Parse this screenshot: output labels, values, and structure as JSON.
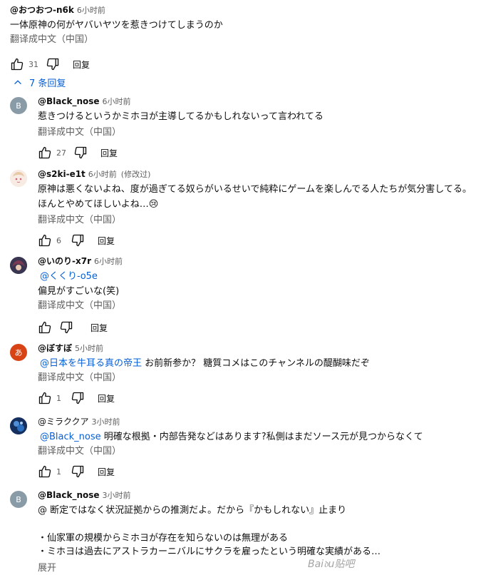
{
  "top_comment": {
    "author": "@おつおつ-n6k",
    "time": "6小时前",
    "text": "一体原神の何がヤバいヤツを惹きつけてしまうのか",
    "translate": "翻译成中文（中国）",
    "likes": "31",
    "reply_label": "回复"
  },
  "replies_toggle": {
    "label": "7 条回复"
  },
  "replies": [
    {
      "author": "@Black_nose",
      "time": "6小时前",
      "avatar_letter": "B",
      "avatar_color": "#8a9ba8",
      "lines": [
        "惹きつけるというかミホヨが主導してるかもしれないって言われてる"
      ],
      "translate": "翻译成中文（中国）",
      "likes": "27",
      "reply_label": "回复"
    },
    {
      "author": "@s2ki-e1t",
      "time": "6小时前",
      "edited": "(修改过)",
      "lines": [
        "原神は悪くないよね、度が過ぎてる奴らがいるせいで純粋にゲームを楽しんでる人たちが気分害してる。",
        "ほんとやめてほしいよね…😢"
      ],
      "translate": "翻译成中文（中国）",
      "likes": "6",
      "reply_label": "回复"
    },
    {
      "author": "@いのり-x7r",
      "time": "6小时前",
      "mention": "@くくり-o5e",
      "lines": [
        "偏見がすごいな(笑)"
      ],
      "translate": "翻译成中文（中国）",
      "reply_label": "回复"
    },
    {
      "author": "@ぼすぼ",
      "time": "5小时前",
      "avatar_letter": "あ",
      "avatar_color": "#d84315",
      "mention": "@日本を牛耳る真の帝王",
      "mention_rest": "お前新参か？ 糖質コメはこのチャンネルの醍醐味だぞ",
      "translate": "翻译成中文（中国）",
      "likes": "1",
      "reply_label": "回复"
    },
    {
      "author": "@ミラククア",
      "time": "3小时前",
      "mention": "@Black_nose",
      "mention_rest": "明確な根拠・内部告発などはあります?私側はまだソース元が見つからなくて",
      "translate": "翻译成中文（中国）",
      "likes": "1",
      "reply_label": "回复"
    },
    {
      "author": "@Black_nose",
      "time": "3小时前",
      "avatar_letter": "B",
      "avatar_color": "#8a9ba8",
      "lines": [
        "@ 断定ではなく状況証拠からの推測だよ。だから『かもしれない』止まり",
        "",
        "・仙家軍の規模からミホヨが存在を知らないのは無理がある",
        "・ミホヨは過去にアストラカーニバルにサクラを雇ったという明確な実績がある…"
      ],
      "more": "展开"
    }
  ],
  "watermark": "Bai𝔡u贴吧"
}
